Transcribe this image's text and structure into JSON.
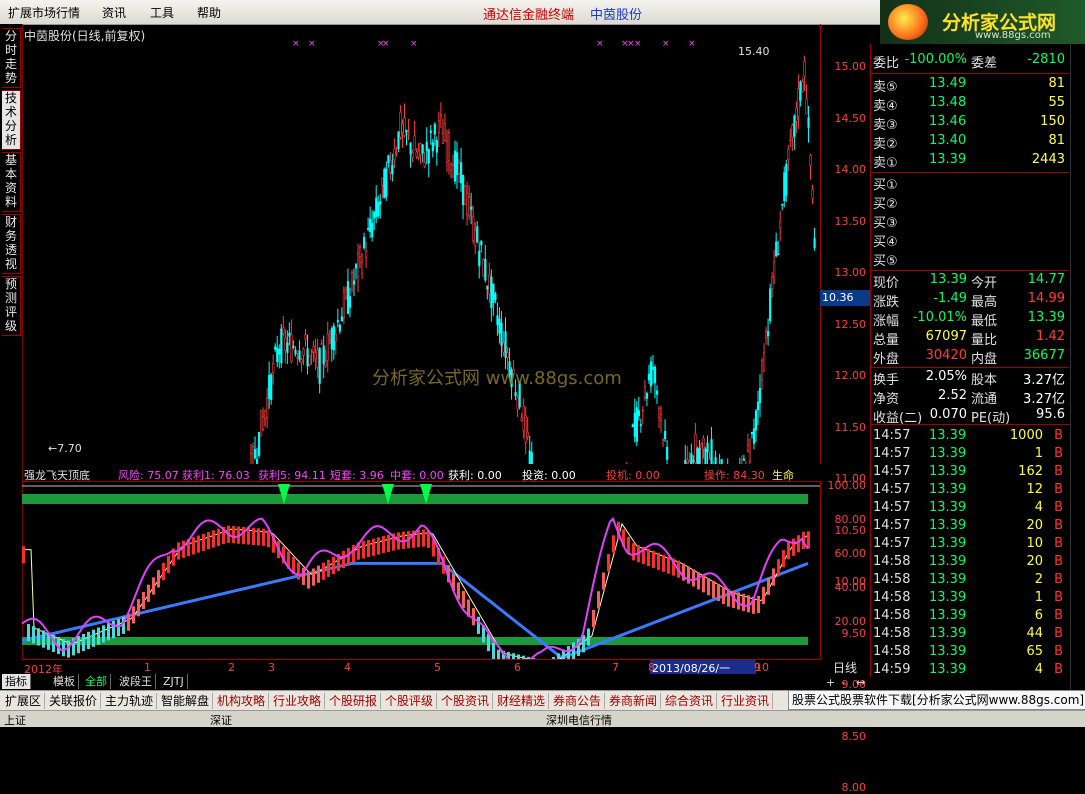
{
  "menu": {
    "items": [
      "扩展市场行情",
      "资讯",
      "工具",
      "帮助"
    ],
    "app_title": "通达信金融终端",
    "stock_title": "中茵股份"
  },
  "logo": {
    "text": "分析家公式网",
    "url": "www.88gs.com"
  },
  "left_tabs": [
    "分时走势",
    "技术分析",
    "基本资料",
    "财务透视",
    "预测评级"
  ],
  "chart": {
    "name": "中茵股份(日线,前复权)",
    "high_label": "15.40",
    "low_label": "←7.70",
    "current_price": "10.36",
    "price_ticks": [
      "15.00",
      "14.50",
      "14.00",
      "13.50",
      "13.00",
      "12.50",
      "12.00",
      "11.50",
      "11.00",
      "10.50",
      "10.00",
      "9.50",
      "9.00",
      "8.50",
      "8.00"
    ],
    "watermark": "分析家公式网 www.88gs.com"
  },
  "indicator": {
    "name": "强龙飞天顶底",
    "risk": "风险: 75.07",
    "profit1": "获利1: 76.03",
    "profit5": "获利5: 94.11",
    "short": "短套: 3.96",
    "mid": "中套: 0.00",
    "gain": "获利: 0.00",
    "invest": "投资: 0.00",
    "spec": "投机: 0.00",
    "oper": "操作: 84.30",
    "life": "生命",
    "ticks": [
      "100.00",
      "80.00",
      "60.00",
      "40.00",
      "20.00"
    ]
  },
  "time_axis": {
    "labels": [
      "2012年",
      "1",
      "2",
      "3",
      "4",
      "5",
      "6",
      "7",
      "8",
      "9",
      "10"
    ],
    "selected": "2013/08/26/一",
    "period": "日线"
  },
  "bottom_tabs1": [
    "指标",
    "模板",
    "全部",
    "波段王",
    "ZJTJ"
  ],
  "bottom_tabs2": [
    "扩展区",
    "关联报价",
    "主力轨迹",
    "智能解盘",
    "机构攻略",
    "行业攻略",
    "个股研报",
    "个股评级",
    "个股资讯",
    "财经精选",
    "券商公告",
    "券商新闻",
    "综合资讯",
    "行业资讯"
  ],
  "ad_text": "股票公式股票软件下载[分析家公式网www.88gs.com]",
  "status": [
    "上证",
    "深证",
    "深圳电信行情"
  ],
  "quote": {
    "weibi_label": "委比",
    "weibi": "-100.00%",
    "weicha_label": "委差",
    "weicha": "-2810",
    "sell": [
      {
        "label": "卖⑤",
        "price": "13.49",
        "vol": "81"
      },
      {
        "label": "卖④",
        "price": "13.48",
        "vol": "55"
      },
      {
        "label": "卖③",
        "price": "13.46",
        "vol": "150"
      },
      {
        "label": "卖②",
        "price": "13.40",
        "vol": "81"
      },
      {
        "label": "卖①",
        "price": "13.39",
        "vol": "2443"
      }
    ],
    "buy": [
      "买①",
      "买②",
      "买③",
      "买④",
      "买⑤"
    ],
    "stats": [
      {
        "l1": "现价",
        "v1": "13.39",
        "c1": "green",
        "l2": "今开",
        "v2": "14.77",
        "c2": "green"
      },
      {
        "l1": "涨跌",
        "v1": "-1.49",
        "c1": "green",
        "l2": "最高",
        "v2": "14.99",
        "c2": "red"
      },
      {
        "l1": "涨幅",
        "v1": "-10.01%",
        "c1": "green",
        "l2": "最低",
        "v2": "13.39",
        "c2": "green"
      },
      {
        "l1": "总量",
        "v1": "67097",
        "c1": "yellow",
        "l2": "量比",
        "v2": "1.42",
        "c2": "red"
      },
      {
        "l1": "外盘",
        "v1": "30420",
        "c1": "red",
        "l2": "内盘",
        "v2": "36677",
        "c2": "green"
      },
      {
        "l1": "换手",
        "v1": "2.05%",
        "c1": "white",
        "l2": "股本",
        "v2": "3.27亿",
        "c2": "white"
      },
      {
        "l1": "净资",
        "v1": "2.52",
        "c1": "white",
        "l2": "流通",
        "v2": "3.27亿",
        "c2": "white"
      },
      {
        "l1": "收益(二)",
        "v1": "0.070",
        "c1": "white",
        "l2": "PE(动)",
        "v2": "95.6",
        "c2": "white"
      }
    ]
  },
  "trades": [
    {
      "t": "14:57",
      "p": "13.39",
      "v": "1000",
      "bs": "B",
      "vc": "magenta"
    },
    {
      "t": "14:57",
      "p": "13.39",
      "v": "1",
      "bs": "B",
      "vc": "yellow"
    },
    {
      "t": "14:57",
      "p": "13.39",
      "v": "162",
      "bs": "B",
      "vc": "yellow"
    },
    {
      "t": "14:57",
      "p": "13.39",
      "v": "12",
      "bs": "B",
      "vc": "yellow"
    },
    {
      "t": "14:57",
      "p": "13.39",
      "v": "4",
      "bs": "B",
      "vc": "yellow"
    },
    {
      "t": "14:57",
      "p": "13.39",
      "v": "20",
      "bs": "B",
      "vc": "yellow"
    },
    {
      "t": "14:57",
      "p": "13.39",
      "v": "10",
      "bs": "B",
      "vc": "yellow"
    },
    {
      "t": "14:58",
      "p": "13.39",
      "v": "20",
      "bs": "B",
      "vc": "yellow"
    },
    {
      "t": "14:58",
      "p": "13.39",
      "v": "2",
      "bs": "B",
      "vc": "yellow"
    },
    {
      "t": "14:58",
      "p": "13.39",
      "v": "1",
      "bs": "B",
      "vc": "yellow"
    },
    {
      "t": "14:58",
      "p": "13.39",
      "v": "6",
      "bs": "B",
      "vc": "yellow"
    },
    {
      "t": "14:58",
      "p": "13.39",
      "v": "44",
      "bs": "B",
      "vc": "yellow"
    },
    {
      "t": "14:58",
      "p": "13.39",
      "v": "65",
      "bs": "B",
      "vc": "yellow"
    },
    {
      "t": "14:59",
      "p": "13.39",
      "v": "4",
      "bs": "B",
      "vc": "yellow"
    }
  ],
  "colors": {
    "up": "#ff3d3d",
    "down": "#00ffff",
    "green": "#00ff66",
    "accent": "#a00000"
  },
  "zoom": [
    "+",
    "-",
    "↔"
  ]
}
